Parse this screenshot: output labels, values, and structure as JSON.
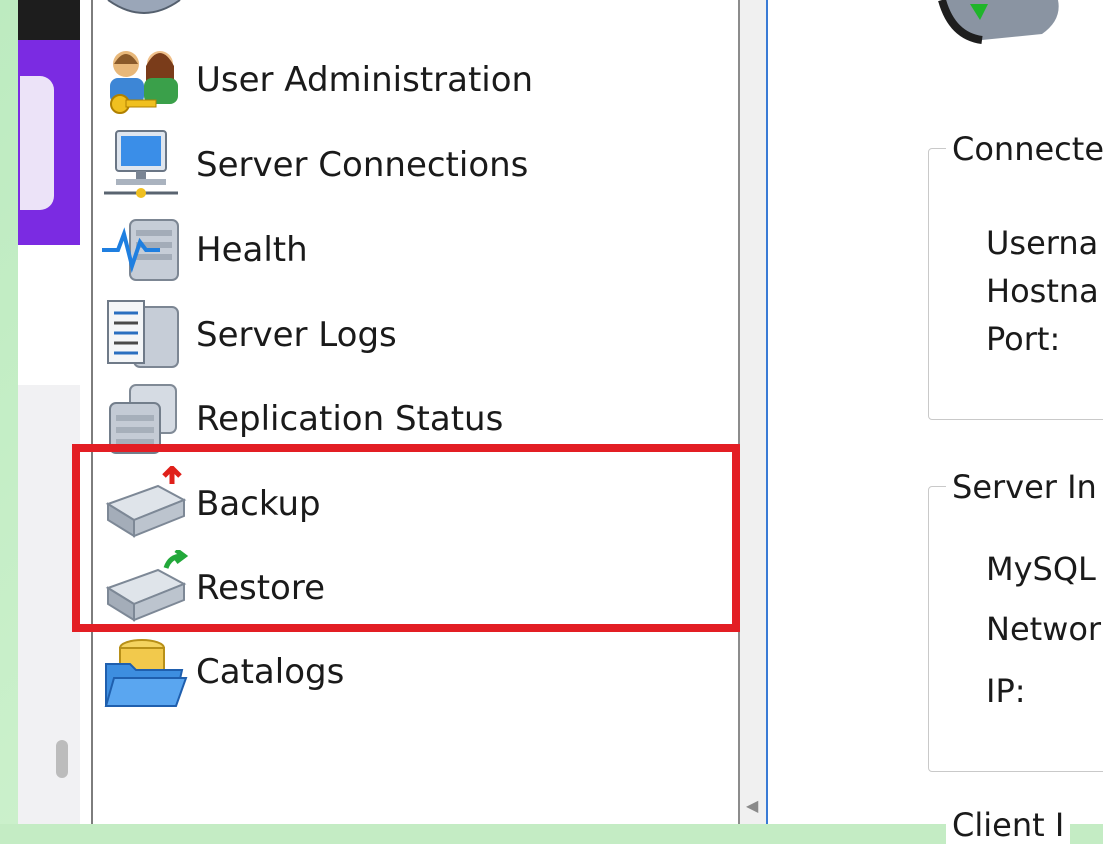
{
  "nav": {
    "items": [
      {
        "label": "User Administration",
        "icon": "users-key-icon"
      },
      {
        "label": "Server Connections",
        "icon": "network-computer-icon"
      },
      {
        "label": "Health",
        "icon": "health-pulse-icon"
      },
      {
        "label": "Server Logs",
        "icon": "server-log-icon"
      },
      {
        "label": "Replication Status",
        "icon": "replication-server-icon"
      },
      {
        "label": "Backup",
        "icon": "backup-disk-icon"
      },
      {
        "label": "Restore",
        "icon": "restore-disk-icon"
      },
      {
        "label": "Catalogs",
        "icon": "catalog-folder-icon"
      }
    ]
  },
  "connected": {
    "title": "Connecte",
    "fields": [
      "Userna",
      "Hostna",
      "Port:"
    ]
  },
  "server_info": {
    "title": "Server In",
    "fields": [
      "MySQL",
      "Networ",
      "IP:"
    ]
  },
  "client_info": {
    "title": "Client I"
  },
  "colors": {
    "highlight": "#e31e24",
    "accent_purple": "#7b2be2",
    "background_green": "#c4ecc4"
  }
}
